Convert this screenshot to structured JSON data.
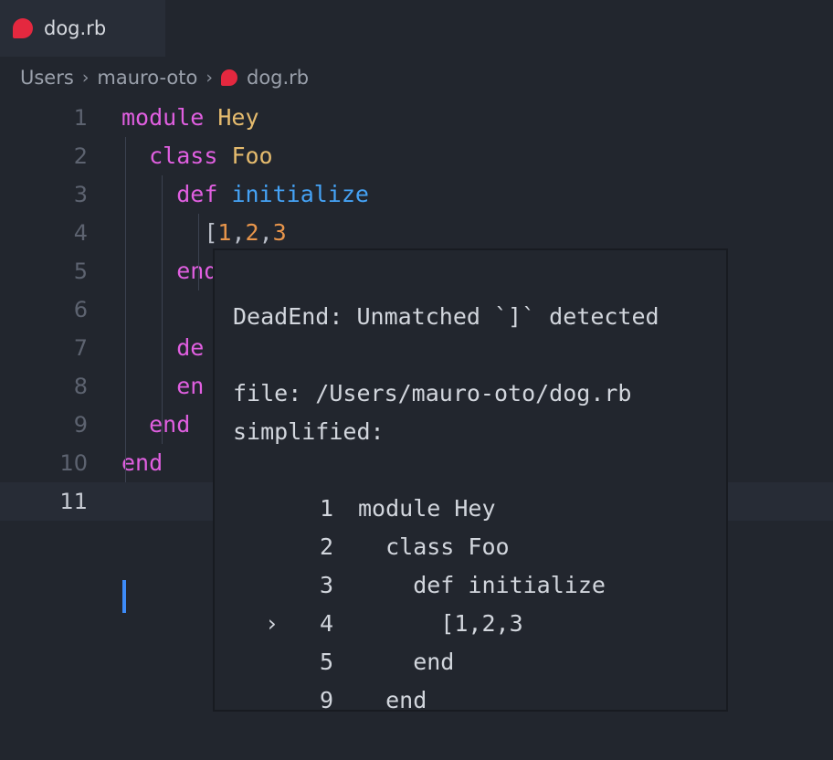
{
  "window": {
    "background": "#22262e",
    "editor_background": "#22262e"
  },
  "tab": {
    "label": "dog.rb",
    "icon": "ruby-gem-icon",
    "active": true
  },
  "breadcrumb": {
    "separator": "›",
    "items": [
      {
        "label": "Users",
        "icon": null
      },
      {
        "label": "mauro-oto",
        "icon": null
      },
      {
        "label": "dog.rb",
        "icon": "ruby-gem-icon"
      }
    ]
  },
  "editor": {
    "current_line": 11,
    "cursor_column": 1,
    "selection": {
      "line": 4,
      "text": "[1,2,3"
    },
    "lines": [
      {
        "num": "1",
        "indent": 0,
        "tokens": [
          {
            "t": "module",
            "c": "kw"
          },
          {
            "t": " ",
            "c": "pun"
          },
          {
            "t": "Hey",
            "c": "cls"
          }
        ]
      },
      {
        "num": "2",
        "indent": 1,
        "tokens": [
          {
            "t": "  ",
            "c": "pun"
          },
          {
            "t": "class",
            "c": "kw"
          },
          {
            "t": " ",
            "c": "pun"
          },
          {
            "t": "Foo",
            "c": "cls"
          }
        ]
      },
      {
        "num": "3",
        "indent": 2,
        "tokens": [
          {
            "t": "    ",
            "c": "pun"
          },
          {
            "t": "def",
            "c": "kw"
          },
          {
            "t": " ",
            "c": "pun"
          },
          {
            "t": "initialize",
            "c": "mth"
          }
        ]
      },
      {
        "num": "4",
        "indent": 3,
        "tokens": [
          {
            "t": "      ",
            "c": "pun"
          },
          {
            "t": "[",
            "c": "pun"
          },
          {
            "t": "1",
            "c": "num"
          },
          {
            "t": ",",
            "c": "pun"
          },
          {
            "t": "2",
            "c": "num"
          },
          {
            "t": ",",
            "c": "pun"
          },
          {
            "t": "3",
            "c": "num"
          }
        ]
      },
      {
        "num": "5",
        "indent": 2,
        "tokens": [
          {
            "t": "    ",
            "c": "pun"
          },
          {
            "t": "end",
            "c": "kw"
          }
        ]
      },
      {
        "num": "6",
        "indent": 2,
        "tokens": []
      },
      {
        "num": "7",
        "indent": 2,
        "tokens": [
          {
            "t": "    ",
            "c": "pun"
          },
          {
            "t": "de",
            "c": "kw"
          }
        ]
      },
      {
        "num": "8",
        "indent": 2,
        "tokens": [
          {
            "t": "    ",
            "c": "pun"
          },
          {
            "t": "en",
            "c": "kw"
          }
        ]
      },
      {
        "num": "9",
        "indent": 1,
        "tokens": [
          {
            "t": "  ",
            "c": "pun"
          },
          {
            "t": "end",
            "c": "kw"
          }
        ]
      },
      {
        "num": "10",
        "indent": 0,
        "tokens": [
          {
            "t": "end",
            "c": "kw"
          }
        ]
      },
      {
        "num": "11",
        "indent": 0,
        "tokens": []
      }
    ],
    "colors": {
      "keyword": "#e05fe0",
      "constant": "#e5bb6e",
      "method": "#45a2f5",
      "number": "#e8954b",
      "punctuation": "#b9bec8",
      "line_number": "#5d6370",
      "line_number_active": "#c8ccd4",
      "selection": "#2d3e55",
      "caret": "#3d8bf8",
      "error_underline": "#e03b3b"
    }
  },
  "tooltip": {
    "title": "DeadEnd: Unmatched `]` detected",
    "file_label": "file: /Users/mauro-oto/dog.rb",
    "simplified_label": "simplified:",
    "marker": "›",
    "code": [
      {
        "marker": "",
        "num": "1",
        "src": "module Hey"
      },
      {
        "marker": "",
        "num": "2",
        "src": "  class Foo"
      },
      {
        "marker": "",
        "num": "3",
        "src": "    def initialize"
      },
      {
        "marker": "›",
        "num": "4",
        "src": "      [1,2,3"
      },
      {
        "marker": "",
        "num": "5",
        "src": "    end"
      },
      {
        "marker": "",
        "num": "9",
        "src": "  end"
      }
    ]
  }
}
